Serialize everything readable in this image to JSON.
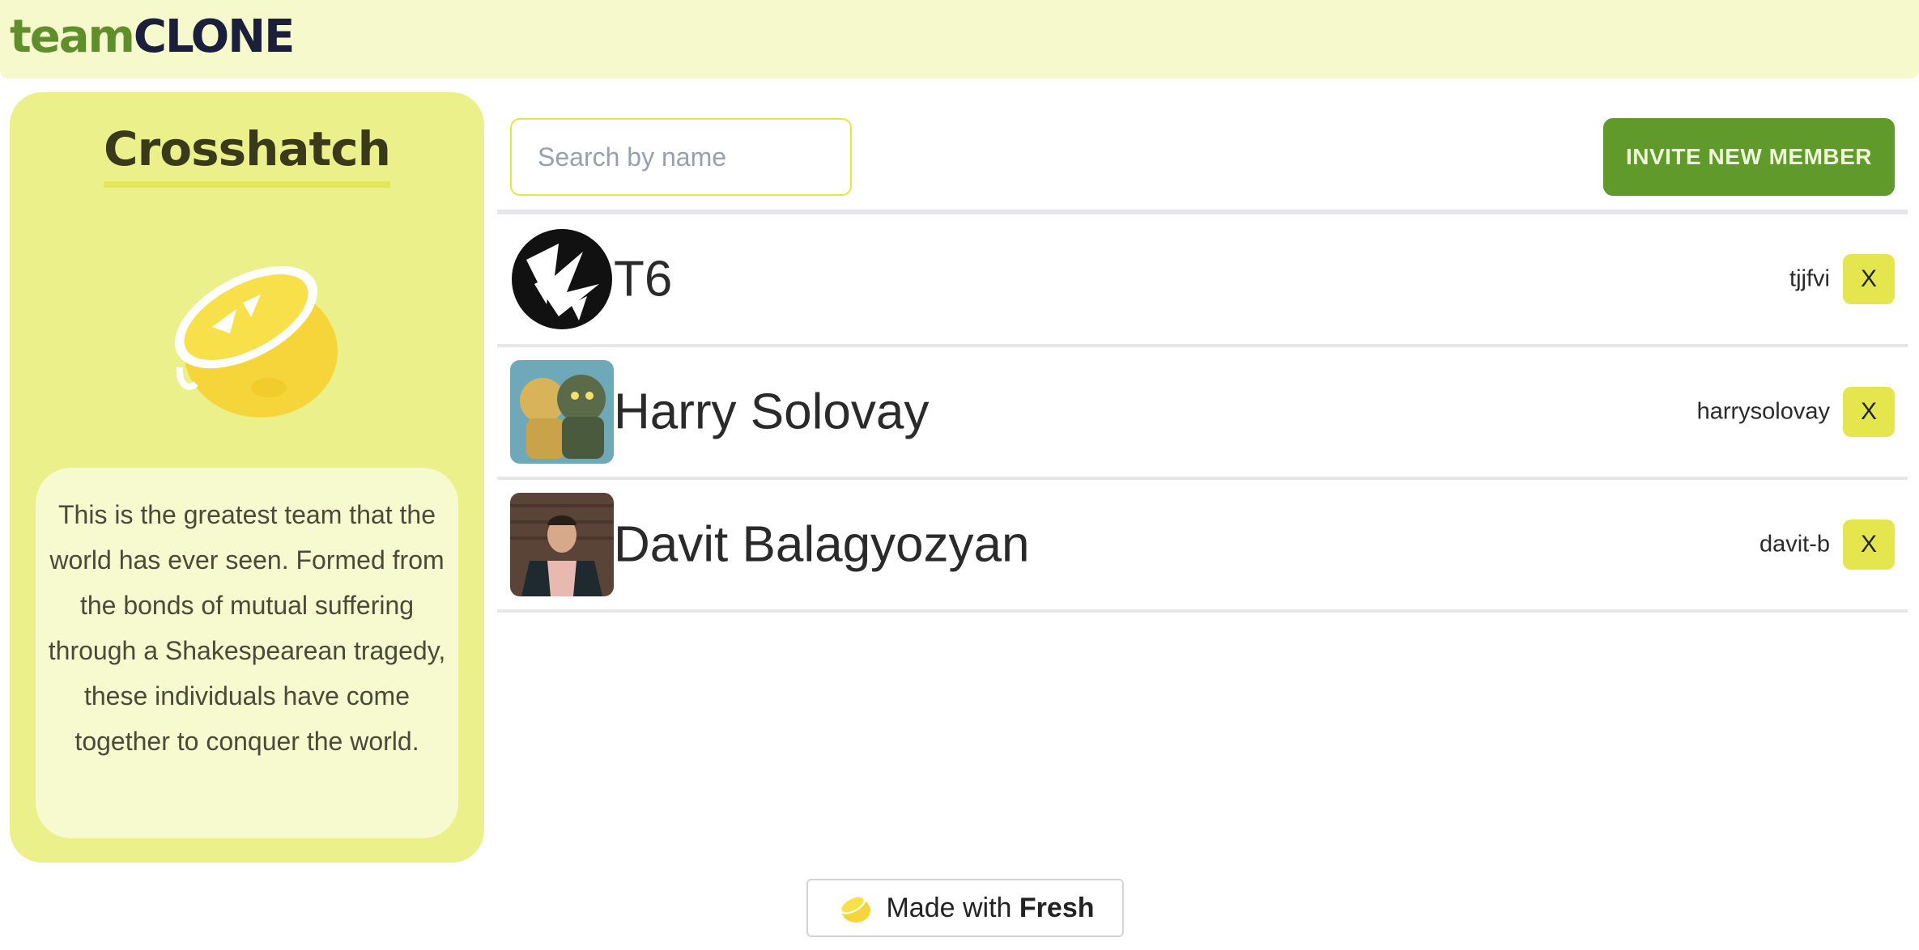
{
  "header": {
    "logo_part1": "team",
    "logo_part2": "CLONE"
  },
  "team": {
    "name": "Crosshatch",
    "logo_icon": "lemon-icon",
    "description": "This is the greatest team that the world has ever seen. Formed from the bonds of mutual suffering through a Shakespearean tragedy, these individuals have come together to conquer the world."
  },
  "search": {
    "placeholder": "Search by name",
    "value": ""
  },
  "invite_button": "INVITE NEW MEMBER",
  "members": [
    {
      "name": "T6",
      "username": "tjjfvi",
      "remove_label": "X"
    },
    {
      "name": "Harry Solovay",
      "username": "harrysolovay",
      "remove_label": "X"
    },
    {
      "name": "Davit Balagyozyan",
      "username": "davit-b",
      "remove_label": "X"
    }
  ],
  "footer": {
    "made_with": "Made with",
    "brand": "Fresh",
    "icon": "lemon-icon"
  },
  "colors": {
    "accent_green": "#5f9a2a",
    "sidebar_yellow": "#ecf08a",
    "header_bg": "#f6f9cc",
    "remove_button": "#e5e64e"
  }
}
